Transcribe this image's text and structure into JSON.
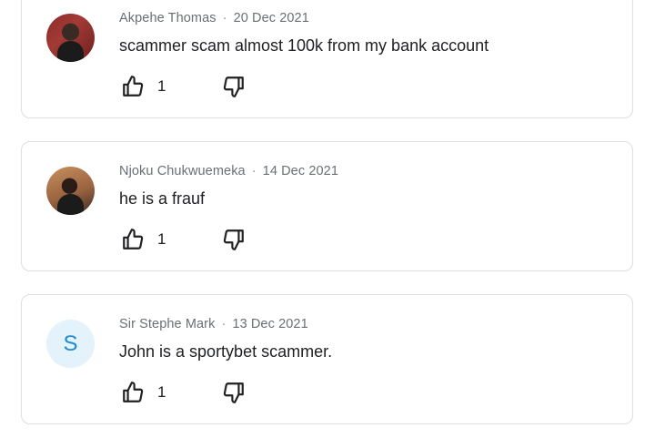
{
  "comments": [
    {
      "author": "Akpehe Thomas",
      "separator": "·",
      "date": "20 Dec 2021",
      "text": "scammer scam almost 100k from my bank account",
      "likes": "1",
      "avatar_type": "photo"
    },
    {
      "author": "Njoku Chukwuemeka",
      "separator": "·",
      "date": "14 Dec 2021",
      "text": "he is a frauf",
      "likes": "1",
      "avatar_type": "photo"
    },
    {
      "author": "Sir Stephe Mark",
      "separator": "·",
      "date": "13 Dec 2021",
      "text": "John is a sportybet scammer.",
      "likes": "1",
      "avatar_type": "letter",
      "avatar_letter": "S"
    }
  ],
  "icons": {
    "like": "thumbs-up-icon",
    "dislike": "thumbs-down-icon"
  },
  "colors": {
    "letter_avatar_bg": "#e3f2fb",
    "letter_avatar_fg": "#1e8ccf",
    "card_border": "#dcdfe3",
    "meta_text": "#6b6f74"
  }
}
